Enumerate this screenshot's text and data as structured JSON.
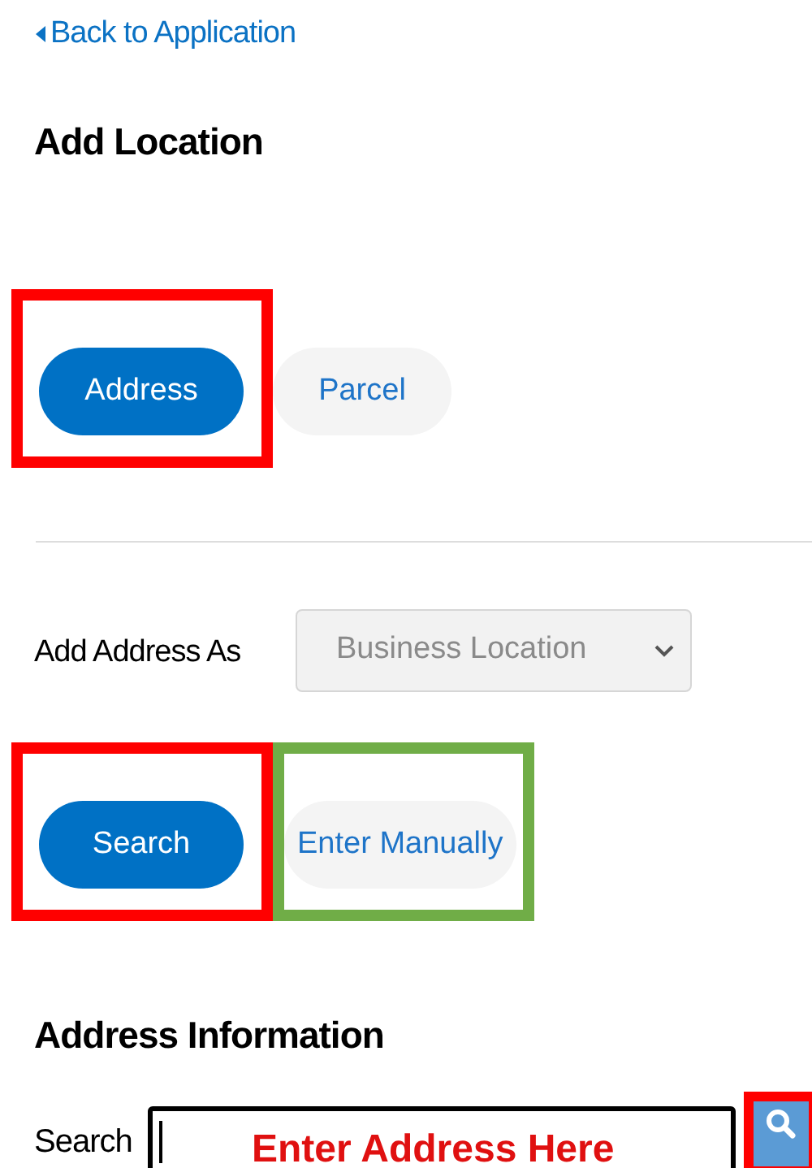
{
  "back_link": {
    "label": "Back to Application"
  },
  "heading": "Add Location",
  "location_type_tabs": [
    {
      "label": "Address",
      "selected": true,
      "color": "#ff0000"
    },
    {
      "label": "Parcel",
      "selected": false
    }
  ],
  "add_address_as": {
    "label": "Add Address As",
    "value": "Business Location",
    "disabled": true
  },
  "entry_mode_tabs": [
    {
      "label": "Search",
      "selected": true,
      "color": "#ff0000"
    },
    {
      "label": "Enter Manually",
      "selected": false,
      "color": "#70ad47"
    }
  ],
  "section_title": "Address Information",
  "search": {
    "label": "Search",
    "annotation": "Enter Address Here",
    "button": {
      "color": "#ff0000"
    }
  }
}
